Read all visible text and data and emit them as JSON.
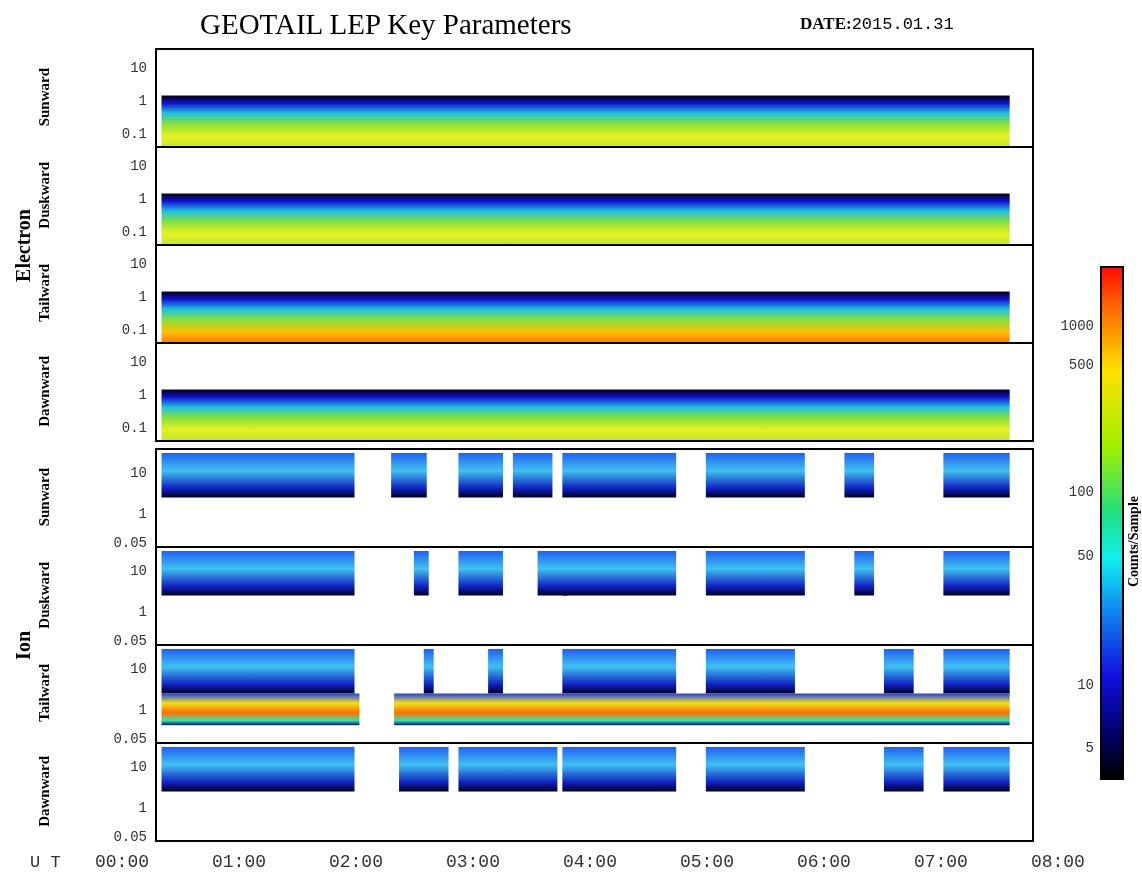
{
  "title": "GEOTAIL LEP Key Parameters",
  "date": "**DATE:**2015.01.31",
  "groups": [
    {
      "name": "Electron",
      "kind": "electron",
      "panels": [
        {
          "label": "Sunward",
          "y_ticks": [
            "10",
            "1",
            "0.1"
          ]
        },
        {
          "label": "Duskward",
          "y_ticks": [
            "10",
            "1",
            "0.1"
          ]
        },
        {
          "label": "Tailward",
          "y_ticks": [
            "10",
            "1",
            "0.1"
          ]
        },
        {
          "label": "Dawnward",
          "y_ticks": [
            "10",
            "1",
            "0.1"
          ]
        }
      ]
    },
    {
      "name": "Ion",
      "kind": "ion",
      "panels": [
        {
          "label": "Sunward",
          "y_ticks": [
            "10",
            "1",
            "0.05"
          ]
        },
        {
          "label": "Duskward",
          "y_ticks": [
            "10",
            "1",
            "0.05"
          ]
        },
        {
          "label": "Tailward",
          "y_ticks": [
            "10",
            "1",
            "0.05"
          ]
        },
        {
          "label": "Dawnward",
          "y_ticks": [
            "10",
            "1",
            "0.05"
          ]
        }
      ]
    }
  ],
  "time_axis": {
    "label": "U T",
    "ticks": [
      "00:00",
      "01:00",
      "02:00",
      "03:00",
      "04:00",
      "05:00",
      "06:00",
      "07:00",
      "08:00"
    ]
  },
  "colorbar": {
    "label": "Counts/Sample",
    "ticks": [
      "1000",
      "500",
      "100",
      "50",
      "10",
      "5"
    ]
  }
}
